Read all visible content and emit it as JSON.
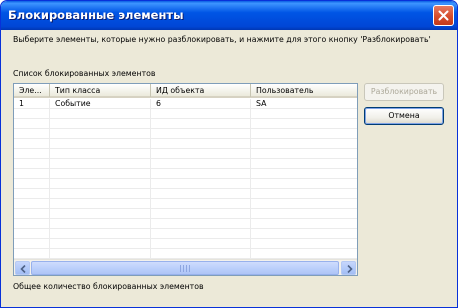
{
  "window": {
    "title": "Блокированные элементы",
    "close_icon": "close-icon"
  },
  "instruction": "Выберите элементы, которые нужно разблокировать, и нажмите для этого кнопку 'Разблокировать'",
  "list_label": "Список блокированных элементов",
  "table": {
    "columns": [
      "Эле...",
      "Тип класса",
      "ИД объекта",
      "Пользователь"
    ],
    "rows": [
      [
        "1",
        "Событие",
        "6",
        "SA"
      ]
    ]
  },
  "buttons": {
    "unlock": "Разблокировать",
    "cancel": "Отмена"
  },
  "total_label": "Общее количество блокированных элементов",
  "colors": {
    "titlebar": "#0055e5",
    "dialog_bg": "#ece9d8",
    "close_button": "#d64d2c"
  }
}
